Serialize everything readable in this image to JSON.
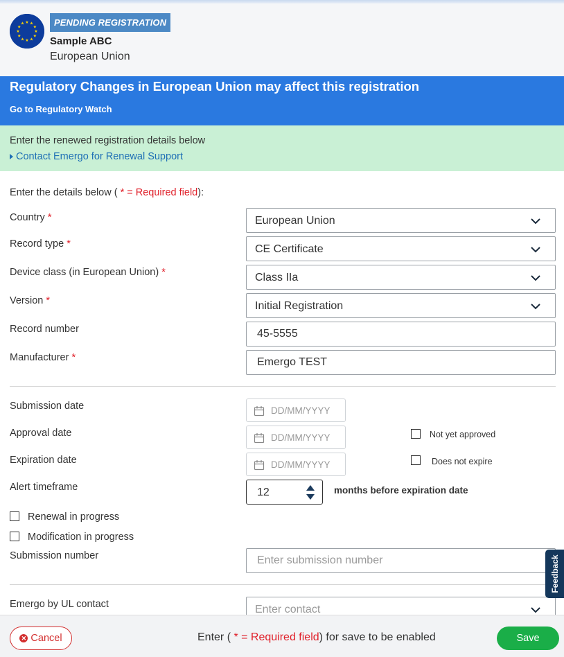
{
  "header": {
    "badge": "PENDING REGISTRATION",
    "name": "Sample ABC",
    "region": "European Union"
  },
  "regulatory_banner": {
    "title": "Regulatory Changes in European Union may affect this registration",
    "link": "Go to Regulatory Watch"
  },
  "renewal_banner": {
    "message": "Enter the renewed registration details below",
    "link": "Contact Emergo for Renewal Support"
  },
  "form": {
    "intro_prefix": "Enter the details below (",
    "intro_required": " * = Required field",
    "intro_suffix": "):",
    "required_mark": "*",
    "country": {
      "label": "Country",
      "value": "European Union"
    },
    "record_type": {
      "label": "Record type",
      "value": "CE Certificate"
    },
    "device_class": {
      "label": "Device class (in European Union)",
      "value": "Class IIa"
    },
    "version": {
      "label": "Version",
      "value": "Initial Registration"
    },
    "record_number": {
      "label": "Record number",
      "value": "45-5555"
    },
    "manufacturer": {
      "label": "Manufacturer",
      "value": "Emergo TEST"
    },
    "submission_date": {
      "label": "Submission date",
      "placeholder": "DD/MM/YYYY"
    },
    "approval_date": {
      "label": "Approval date",
      "placeholder": "DD/MM/YYYY"
    },
    "expiration_date": {
      "label": "Expiration date",
      "placeholder": "DD/MM/YYYY"
    },
    "not_yet_approved": "Not yet approved",
    "does_not_expire": "Does not expire",
    "alert_timeframe": {
      "label": "Alert timeframe",
      "value": "12",
      "suffix": "months before expiration date"
    },
    "renewal_in_progress": "Renewal in progress",
    "modification_in_progress": "Modification in progress",
    "submission_number": {
      "label": "Submission number",
      "placeholder": "Enter submission number"
    },
    "contact": {
      "label": "Emergo by UL contact",
      "placeholder": "Enter contact"
    }
  },
  "feedback": "Feedback",
  "footer": {
    "cancel": "Cancel",
    "msg_prefix": "Enter (",
    "msg_required": " * = Required field",
    "msg_suffix": ") for save to be enabled",
    "save": "Save"
  },
  "colors": {
    "banner_blue": "#2a79e0",
    "banner_green": "#c9f0d5",
    "badge": "#4c89c5",
    "required": "#e0212b",
    "save": "#1aae48",
    "cancel": "#d32f2f"
  }
}
